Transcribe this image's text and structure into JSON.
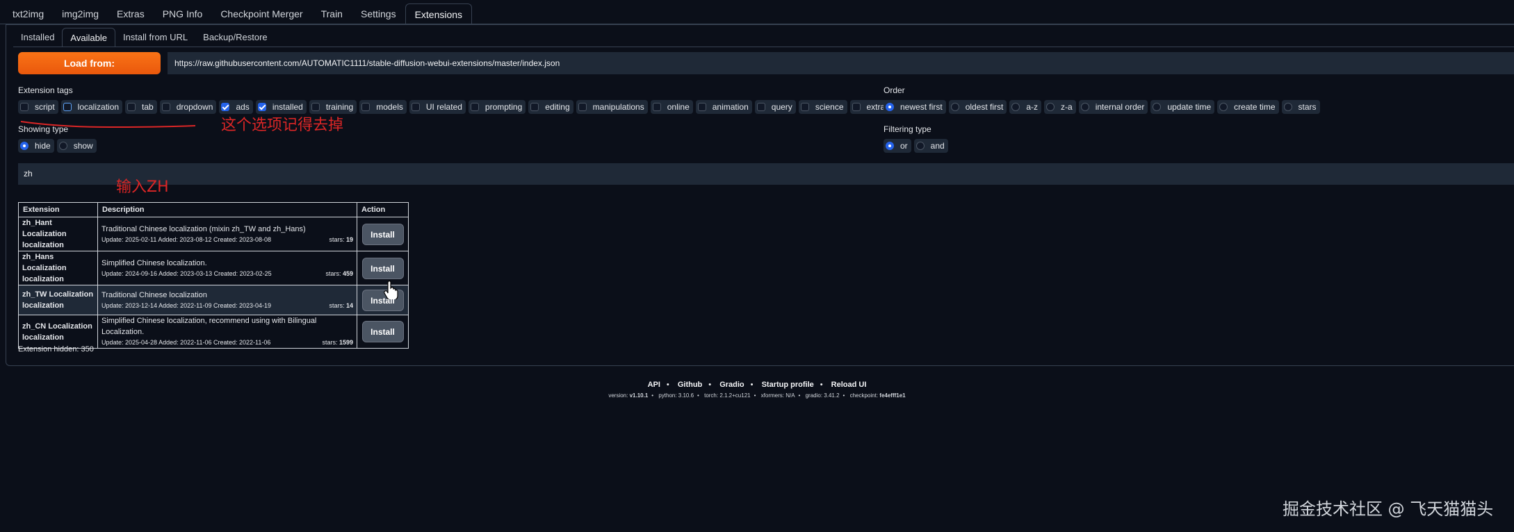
{
  "top_tabs": [
    "txt2img",
    "img2img",
    "Extras",
    "PNG Info",
    "Checkpoint Merger",
    "Train",
    "Settings",
    "Extensions"
  ],
  "sub_tabs": [
    "Installed",
    "Available",
    "Install from URL",
    "Backup/Restore"
  ],
  "load_button": "Load from:",
  "url": "https://raw.githubusercontent.com/AUTOMATIC1111/stable-diffusion-webui-extensions/master/index.json",
  "extension_tags": {
    "label": "Extension tags",
    "items": [
      {
        "label": "script",
        "checked": false
      },
      {
        "label": "localization",
        "checked": false
      },
      {
        "label": "tab",
        "checked": false
      },
      {
        "label": "dropdown",
        "checked": false
      },
      {
        "label": "ads",
        "checked": true
      },
      {
        "label": "installed",
        "checked": true
      },
      {
        "label": "training",
        "checked": false
      },
      {
        "label": "models",
        "checked": false
      },
      {
        "label": "UI related",
        "checked": false
      },
      {
        "label": "prompting",
        "checked": false
      },
      {
        "label": "editing",
        "checked": false
      },
      {
        "label": "manipulations",
        "checked": false
      },
      {
        "label": "online",
        "checked": false
      },
      {
        "label": "animation",
        "checked": false
      },
      {
        "label": "query",
        "checked": false
      },
      {
        "label": "science",
        "checked": false
      },
      {
        "label": "extras",
        "checked": false
      }
    ]
  },
  "order": {
    "label": "Order",
    "items": [
      {
        "label": "newest first",
        "checked": true
      },
      {
        "label": "oldest first",
        "checked": false
      },
      {
        "label": "a-z",
        "checked": false
      },
      {
        "label": "z-a",
        "checked": false
      },
      {
        "label": "internal order",
        "checked": false
      },
      {
        "label": "update time",
        "checked": false
      },
      {
        "label": "create time",
        "checked": false
      },
      {
        "label": "stars",
        "checked": false
      }
    ]
  },
  "showing_type": {
    "label": "Showing type",
    "items": [
      {
        "label": "hide",
        "checked": true
      },
      {
        "label": "show",
        "checked": false
      }
    ]
  },
  "filtering_type": {
    "label": "Filtering type",
    "items": [
      {
        "label": "or",
        "checked": true
      },
      {
        "label": "and",
        "checked": false
      }
    ]
  },
  "annotation_1": "这个选项记得去掉",
  "annotation_2": "输入ZH",
  "search_value": "zh",
  "table": {
    "headers": [
      "Extension",
      "Description",
      "Action"
    ],
    "rows": [
      {
        "name": "zh_Hant Localization",
        "tag": "localization",
        "desc": "Traditional Chinese localization (mixin zh_TW and zh_Hans)",
        "meta": "Update: 2025-02-11 Added: 2023-08-12 Created: 2023-08-08",
        "stars_label": "stars:",
        "stars": "19",
        "action": "Install"
      },
      {
        "name": "zh_Hans Localization",
        "tag": "localization",
        "desc": "Simplified Chinese localization.",
        "meta": "Update: 2024-09-16 Added: 2023-03-13 Created: 2023-02-25",
        "stars_label": "stars:",
        "stars": "459",
        "action": "Install"
      },
      {
        "name": "zh_TW Localization",
        "tag": "localization",
        "desc": "Traditional Chinese localization",
        "meta": "Update: 2023-12-14 Added: 2022-11-09 Created: 2023-04-19",
        "stars_label": "stars:",
        "stars": "14",
        "action": "Install"
      },
      {
        "name": "zh_CN Localization",
        "tag": "localization",
        "desc": "Simplified Chinese localization, recommend using with Bilingual Localization.",
        "meta": "Update: 2025-04-28 Added: 2022-11-06 Created: 2022-11-06",
        "stars_label": "stars:",
        "stars": "1599",
        "action": "Install"
      }
    ]
  },
  "hidden_count": "Extension hidden: 350",
  "footer": {
    "links": [
      "API",
      "Github",
      "Gradio",
      "Startup profile",
      "Reload UI"
    ],
    "sep": "•",
    "versions": [
      {
        "k": "version: ",
        "v": "v1.10.1"
      },
      {
        "k": "python: ",
        "v": "3.10.6"
      },
      {
        "k": "torch: ",
        "v": "2.1.2+cu121"
      },
      {
        "k": "xformers: ",
        "v": "N/A"
      },
      {
        "k": "gradio: ",
        "v": "3.41.2"
      },
      {
        "k": "checkpoint: ",
        "v": "fe4efff1e1"
      }
    ]
  },
  "watermark": "掘金技术社区 @ 飞天猫猫头",
  "colors": {
    "accent": "#f97316",
    "check": "#2563eb",
    "annotation": "#dc2626"
  }
}
